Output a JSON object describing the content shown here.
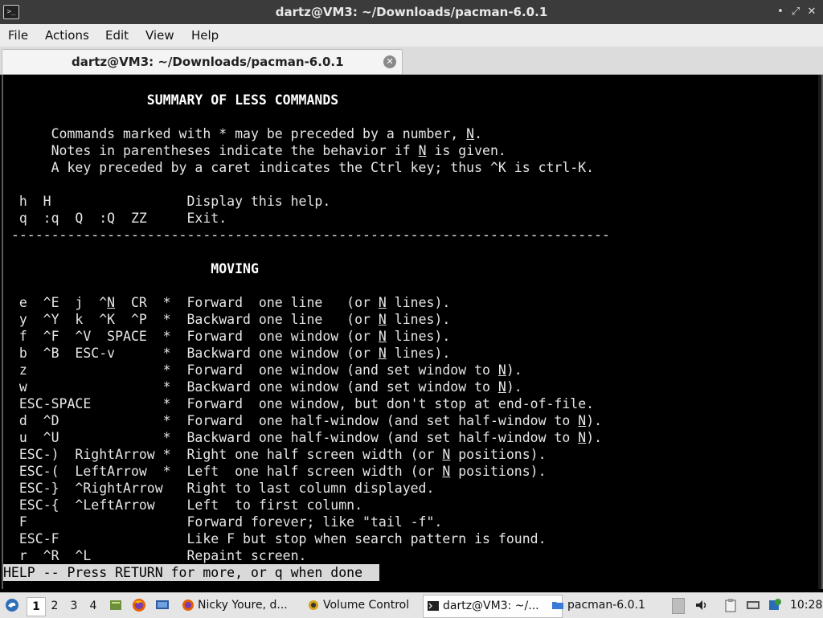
{
  "window": {
    "title": "dartz@VM3: ~/Downloads/pacman-6.0.1",
    "app_icon_glyph": ">_",
    "minimize_glyph": "•",
    "maximize_glyph": "⤢",
    "close_glyph": "✕"
  },
  "menu": {
    "file": "File",
    "actions": "Actions",
    "edit": "Edit",
    "view": "View",
    "help": "Help"
  },
  "tab": {
    "label": "dartz@VM3: ~/Downloads/pacman-6.0.1",
    "close_glyph": "✕"
  },
  "terminal": {
    "lines": [
      "                  SUMMARY OF LESS COMMANDS",
      "",
      "      Commands marked with * may be preceded by a number, N.",
      "      Notes in parentheses indicate the behavior if N is given.",
      "      A key preceded by a caret indicates the Ctrl key; thus ^K is ctrl-K.",
      "",
      "  h  H                 Display this help.",
      "  q  :q  Q  :Q  ZZ     Exit.",
      " ---------------------------------------------------------------------------",
      "",
      "                          MOVING",
      "",
      "  e  ^E  j  ^N  CR  *  Forward  one line   (or N lines).",
      "  y  ^Y  k  ^K  ^P  *  Backward one line   (or N lines).",
      "  f  ^F  ^V  SPACE  *  Forward  one window (or N lines).",
      "  b  ^B  ESC-v      *  Backward one window (or N lines).",
      "  z                 *  Forward  one window (and set window to N).",
      "  w                 *  Backward one window (and set window to N).",
      "  ESC-SPACE         *  Forward  one window, but don't stop at end-of-file.",
      "  d  ^D             *  Forward  one half-window (and set half-window to N).",
      "  u  ^U             *  Backward one half-window (and set half-window to N).",
      "  ESC-)  RightArrow *  Right one half screen width (or N positions).",
      "  ESC-(  LeftArrow  *  Left  one half screen width (or N positions).",
      "  ESC-}  ^RightArrow   Right to last column displayed.",
      "  ESC-{  ^LeftArrow    Left  to first column.",
      "  F                    Forward forever; like \"tail -f\".",
      "  ESC-F                Like F but stop when search pattern is found.",
      "  r  ^R  ^L            Repaint screen."
    ],
    "status": "HELP -- Press RETURN for more, or q when done"
  },
  "taskbar": {
    "workspaces": [
      "1",
      "2",
      "3",
      "4"
    ],
    "active_workspace": "1",
    "tasks": [
      {
        "label": "Nicky Youre, d...",
        "icon": "firefox-icon"
      },
      {
        "label": "Volume Control",
        "icon": "volume-control-icon"
      },
      {
        "label": "dartz@VM3: ~/...",
        "icon": "terminal-icon"
      },
      {
        "label": "pacman-6.0.1",
        "icon": "folder-icon"
      }
    ],
    "clock": "10:28"
  },
  "colors": {
    "titlebar_bg": "#3b3b3b",
    "menubar_bg": "#ececec",
    "terminal_bg": "#000000",
    "terminal_fg": "#e6e6e6",
    "status_bg": "#d9d9d9",
    "taskbar_bg": "#e5e5e5"
  }
}
